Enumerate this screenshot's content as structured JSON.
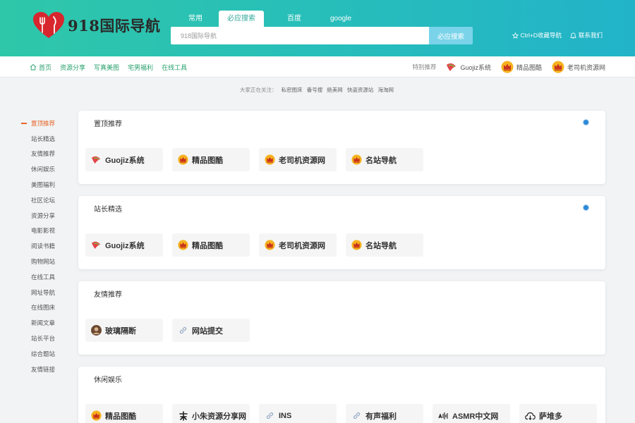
{
  "header": {
    "logo_text": "918国际导航",
    "tabs": [
      "常用",
      "必应搜索",
      "百度",
      "google"
    ],
    "search_placeholder": "918国际导航",
    "search_button": "必应搜索",
    "links": [
      "Ctrl+D收藏导航",
      "联系我们"
    ]
  },
  "subnav": {
    "left": [
      "首页",
      "资源分享",
      "写真美图",
      "宅男福利",
      "在线工具"
    ],
    "right_label": "特别推荐",
    "right": [
      "Guojiz系统",
      "精品图酷",
      "老司机资源网"
    ]
  },
  "hotline": {
    "label": "大家正在关注：",
    "items": [
      "私密图床",
      "番号搜",
      "绝美网",
      "快盗资源站",
      "海淘网"
    ]
  },
  "sidebar": [
    "置顶推荐",
    "站长精选",
    "友情推荐",
    "休闲娱乐",
    "美图福利",
    "社区论坛",
    "资源分享",
    "电影影视",
    "阅读书籍",
    "购物网站",
    "在线工具",
    "网址导航",
    "在线图床",
    "新闻文章",
    "站长平台",
    "综合题站",
    "友情链接"
  ],
  "cards": [
    {
      "title": "置顶推荐",
      "links": [
        {
          "label": "Guojiz系统",
          "icon": "guojiz-icon"
        },
        {
          "label": "精品图酷",
          "icon": "crown-icon"
        },
        {
          "label": "老司机资源网",
          "icon": "crown-icon"
        },
        {
          "label": "名站导航",
          "icon": "crown-icon"
        }
      ]
    },
    {
      "title": "站长精选",
      "links": [
        {
          "label": "Guojiz系统",
          "icon": "guojiz-icon"
        },
        {
          "label": "精品图酷",
          "icon": "crown-icon"
        },
        {
          "label": "老司机资源网",
          "icon": "crown-icon"
        },
        {
          "label": "名站导航",
          "icon": "crown-icon"
        }
      ]
    },
    {
      "title": "友情推荐",
      "links": [
        {
          "label": "玻璃隔断",
          "icon": "avatar-icon"
        },
        {
          "label": "网站提交",
          "icon": "link-icon"
        }
      ]
    },
    {
      "title": "休闲娱乐",
      "links": [
        {
          "label": "精品图酷",
          "icon": "crown-icon"
        },
        {
          "label": "小朱资源分享网",
          "icon": "zhu-icon"
        },
        {
          "label": "INS",
          "icon": "link-icon"
        },
        {
          "label": "有声福利",
          "icon": "link-icon"
        },
        {
          "label": "ASMR中文网",
          "icon": "asmr-icon"
        },
        {
          "label": "萨堆多",
          "icon": "cloud-icon"
        }
      ]
    }
  ],
  "colors": {
    "header_start": "#2fc7a9",
    "header_end": "#22b3c9",
    "accent": "#e8662c",
    "subnav_link": "#2aa16e",
    "dot": "#2d89d8"
  }
}
